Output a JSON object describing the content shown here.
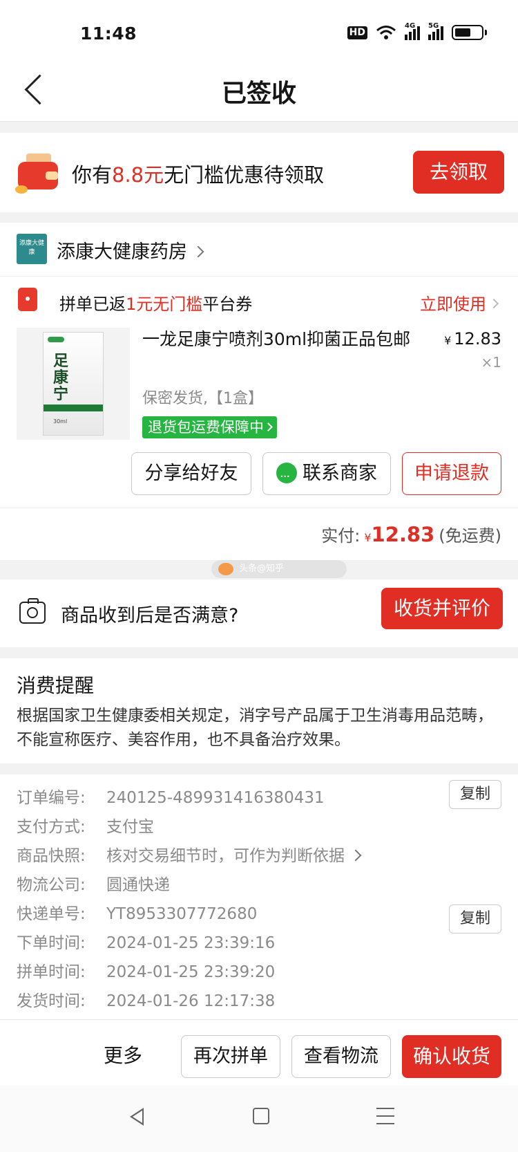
{
  "status_bar": {
    "time": "11:48",
    "hd": "HD",
    "net1": "4G",
    "net2": "5G",
    "battery_level": 0.6
  },
  "nav": {
    "title": "已签收"
  },
  "coupon_banner": {
    "prefix": "你有",
    "amount": "8.8元",
    "suffix": "无门槛优惠待领取",
    "button": "去领取"
  },
  "shop": {
    "logo_text": "添康大健康",
    "name": "添康大健康药房"
  },
  "rebate": {
    "prefix": "拼单已返",
    "highlight": "1元无门槛",
    "suffix": "平台券",
    "action": "立即使用"
  },
  "product": {
    "image_brand": "足康宁",
    "image_ml": "30ml",
    "title": "一龙足康宁喷剂30ml抑菌正品包邮",
    "price_symbol": "¥",
    "price": "12.83",
    "quantity": "×1",
    "spec": "保密发货,【1盒】",
    "guarantee": "退货包运费保障中"
  },
  "actions": {
    "share": "分享给好友",
    "contact": "联系商家",
    "refund": "申请退款"
  },
  "payment": {
    "label": "实付:",
    "symbol": "¥",
    "amount": "12.83",
    "note": "(免运费)"
  },
  "watermark": {
    "text": "头条@知乎"
  },
  "confirm": {
    "question": "商品收到后是否满意?",
    "button": "收货并评价"
  },
  "notice": {
    "title": "消费提醒",
    "body": "根据国家卫生健康委相关规定，消字号产品属于卫生消毒用品范畴，不能宣称医疗、美容作用，也不具备治疗效果。"
  },
  "order_info": {
    "rows": [
      {
        "label": "订单编号:",
        "value": "240125-489931416380431"
      },
      {
        "label": "支付方式:",
        "value": "支付宝"
      },
      {
        "label": "商品快照:",
        "value": "核对交易细节时，可作为判断依据"
      },
      {
        "label": "物流公司:",
        "value": "圆通快递"
      },
      {
        "label": "快递单号:",
        "value": "YT8953307772680"
      },
      {
        "label": "下单时间:",
        "value": "2024-01-25 23:39:16"
      },
      {
        "label": "拼单时间:",
        "value": "2024-01-25 23:39:20"
      },
      {
        "label": "发货时间:",
        "value": "2024-01-26 12:17:38"
      }
    ],
    "copy_label": "复制"
  },
  "bottom_bar": {
    "more": "更多",
    "reorder": "再次拼单",
    "logistics": "查看物流",
    "confirm_receipt": "确认收货"
  },
  "colors": {
    "accent": "#e02e24",
    "green": "#27b541",
    "text": "#151515",
    "muted": "#8a8a8a"
  }
}
